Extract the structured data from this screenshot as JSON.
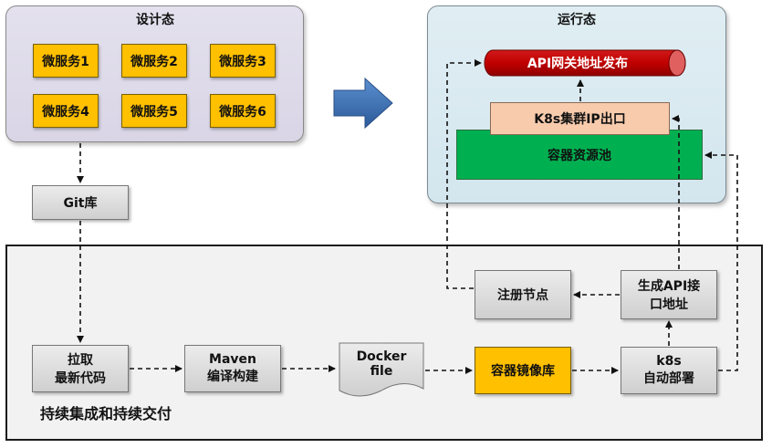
{
  "design_panel": {
    "title": "设计态",
    "services": [
      "微服务1",
      "微服务2",
      "微服务3",
      "微服务4",
      "微服务5",
      "微服务6"
    ]
  },
  "runtime_panel": {
    "title": "运行态",
    "api_gateway": "API网关地址发布",
    "k8s_ip_exit": "K8s集群IP出口",
    "container_pool": "容器资源池"
  },
  "git_repo": "Git库",
  "ci_panel": {
    "title": "持续集成和持续交付",
    "pull_code": "拉取\n最新代码",
    "maven_build": "Maven\n编译构建",
    "docker_file": "Docker\nfile",
    "image_registry": "容器镜像库",
    "k8s_deploy": "k8s\n自动部署",
    "gen_api": "生成API接\n口地址",
    "register_node": "注册节点"
  },
  "colors": {
    "service": "#ffc000",
    "api_gateway": "#c00000",
    "k8s_ip_exit": "#f8cbad",
    "container_pool": "#00b050",
    "big_arrow": "#3a6fb5"
  }
}
